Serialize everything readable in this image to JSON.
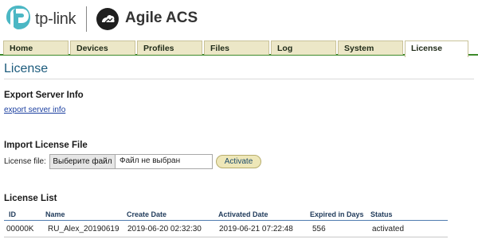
{
  "header": {
    "brand_text": "tp-link",
    "product_text": "Agile ACS"
  },
  "tabs": [
    {
      "label": "Home",
      "active": false
    },
    {
      "label": "Devices",
      "active": false
    },
    {
      "label": "Profiles",
      "active": false
    },
    {
      "label": "Files",
      "active": false
    },
    {
      "label": "Log",
      "active": false
    },
    {
      "label": "System",
      "active": false
    },
    {
      "label": "License",
      "active": true
    }
  ],
  "page": {
    "title": "License"
  },
  "export": {
    "heading": "Export Server Info",
    "link_label": "export server info"
  },
  "import": {
    "heading": "Import License File",
    "file_label": "License file:",
    "choose_button": "Выберите файл",
    "file_status": "Файл не выбран",
    "activate_button": "Activate"
  },
  "license_list": {
    "heading": "License List",
    "columns": [
      "ID",
      "Name",
      "Create Date",
      "Activated Date",
      "Expired in Days",
      "Status"
    ],
    "rows": [
      [
        "00000K",
        "RU_Alex_20190619",
        "2019-06-20 02:32:30",
        "2019-06-21 07:22:48",
        "556",
        "activated"
      ]
    ]
  },
  "colors": {
    "accent_green": "#3d8a2a",
    "tab_bg": "#ece7c7",
    "title_blue": "#1c5b7c",
    "brand_teal": "#4bb7c4"
  },
  "icons": {
    "brand": "tp-link-logo-icon",
    "product": "agile-acs-logo-icon"
  }
}
